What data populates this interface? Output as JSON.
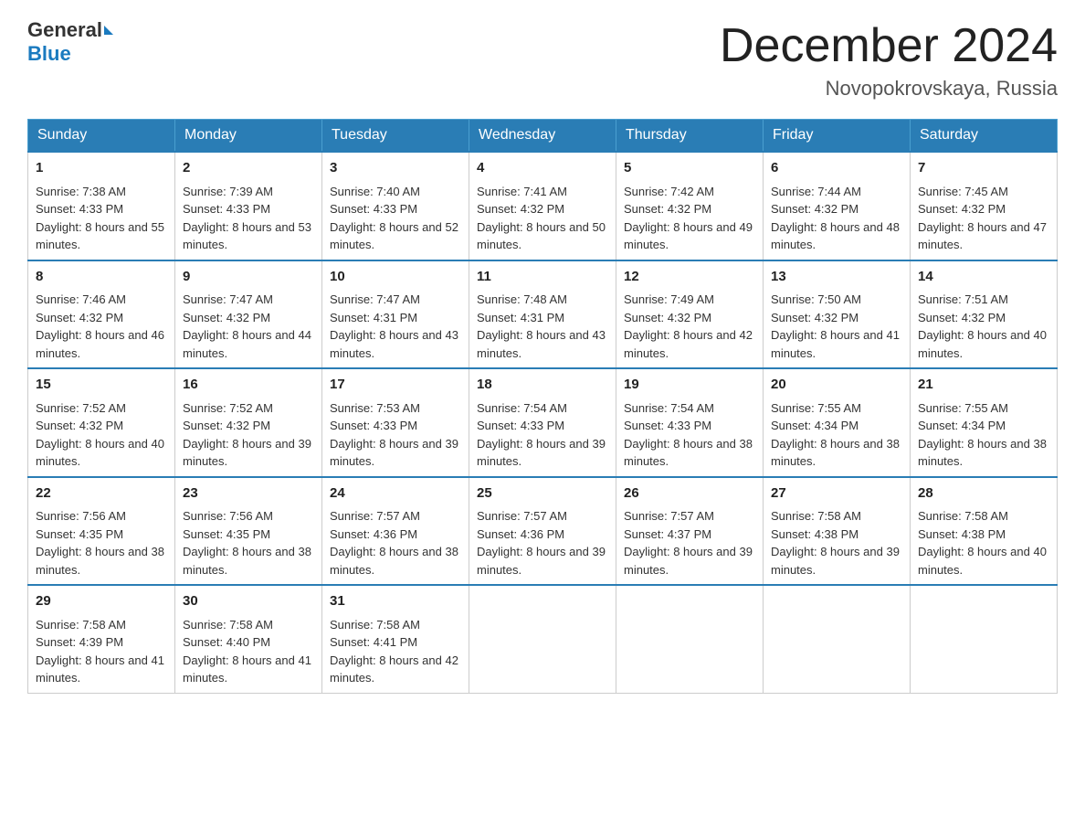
{
  "header": {
    "logo_general": "General",
    "logo_blue": "Blue",
    "month_title": "December 2024",
    "location": "Novopokrovskaya, Russia"
  },
  "days_of_week": [
    "Sunday",
    "Monday",
    "Tuesday",
    "Wednesday",
    "Thursday",
    "Friday",
    "Saturday"
  ],
  "weeks": [
    [
      {
        "day": "1",
        "sunrise": "7:38 AM",
        "sunset": "4:33 PM",
        "daylight": "8 hours and 55 minutes."
      },
      {
        "day": "2",
        "sunrise": "7:39 AM",
        "sunset": "4:33 PM",
        "daylight": "8 hours and 53 minutes."
      },
      {
        "day": "3",
        "sunrise": "7:40 AM",
        "sunset": "4:33 PM",
        "daylight": "8 hours and 52 minutes."
      },
      {
        "day": "4",
        "sunrise": "7:41 AM",
        "sunset": "4:32 PM",
        "daylight": "8 hours and 50 minutes."
      },
      {
        "day": "5",
        "sunrise": "7:42 AM",
        "sunset": "4:32 PM",
        "daylight": "8 hours and 49 minutes."
      },
      {
        "day": "6",
        "sunrise": "7:44 AM",
        "sunset": "4:32 PM",
        "daylight": "8 hours and 48 minutes."
      },
      {
        "day": "7",
        "sunrise": "7:45 AM",
        "sunset": "4:32 PM",
        "daylight": "8 hours and 47 minutes."
      }
    ],
    [
      {
        "day": "8",
        "sunrise": "7:46 AM",
        "sunset": "4:32 PM",
        "daylight": "8 hours and 46 minutes."
      },
      {
        "day": "9",
        "sunrise": "7:47 AM",
        "sunset": "4:32 PM",
        "daylight": "8 hours and 44 minutes."
      },
      {
        "day": "10",
        "sunrise": "7:47 AM",
        "sunset": "4:31 PM",
        "daylight": "8 hours and 43 minutes."
      },
      {
        "day": "11",
        "sunrise": "7:48 AM",
        "sunset": "4:31 PM",
        "daylight": "8 hours and 43 minutes."
      },
      {
        "day": "12",
        "sunrise": "7:49 AM",
        "sunset": "4:32 PM",
        "daylight": "8 hours and 42 minutes."
      },
      {
        "day": "13",
        "sunrise": "7:50 AM",
        "sunset": "4:32 PM",
        "daylight": "8 hours and 41 minutes."
      },
      {
        "day": "14",
        "sunrise": "7:51 AM",
        "sunset": "4:32 PM",
        "daylight": "8 hours and 40 minutes."
      }
    ],
    [
      {
        "day": "15",
        "sunrise": "7:52 AM",
        "sunset": "4:32 PM",
        "daylight": "8 hours and 40 minutes."
      },
      {
        "day": "16",
        "sunrise": "7:52 AM",
        "sunset": "4:32 PM",
        "daylight": "8 hours and 39 minutes."
      },
      {
        "day": "17",
        "sunrise": "7:53 AM",
        "sunset": "4:33 PM",
        "daylight": "8 hours and 39 minutes."
      },
      {
        "day": "18",
        "sunrise": "7:54 AM",
        "sunset": "4:33 PM",
        "daylight": "8 hours and 39 minutes."
      },
      {
        "day": "19",
        "sunrise": "7:54 AM",
        "sunset": "4:33 PM",
        "daylight": "8 hours and 38 minutes."
      },
      {
        "day": "20",
        "sunrise": "7:55 AM",
        "sunset": "4:34 PM",
        "daylight": "8 hours and 38 minutes."
      },
      {
        "day": "21",
        "sunrise": "7:55 AM",
        "sunset": "4:34 PM",
        "daylight": "8 hours and 38 minutes."
      }
    ],
    [
      {
        "day": "22",
        "sunrise": "7:56 AM",
        "sunset": "4:35 PM",
        "daylight": "8 hours and 38 minutes."
      },
      {
        "day": "23",
        "sunrise": "7:56 AM",
        "sunset": "4:35 PM",
        "daylight": "8 hours and 38 minutes."
      },
      {
        "day": "24",
        "sunrise": "7:57 AM",
        "sunset": "4:36 PM",
        "daylight": "8 hours and 38 minutes."
      },
      {
        "day": "25",
        "sunrise": "7:57 AM",
        "sunset": "4:36 PM",
        "daylight": "8 hours and 39 minutes."
      },
      {
        "day": "26",
        "sunrise": "7:57 AM",
        "sunset": "4:37 PM",
        "daylight": "8 hours and 39 minutes."
      },
      {
        "day": "27",
        "sunrise": "7:58 AM",
        "sunset": "4:38 PM",
        "daylight": "8 hours and 39 minutes."
      },
      {
        "day": "28",
        "sunrise": "7:58 AM",
        "sunset": "4:38 PM",
        "daylight": "8 hours and 40 minutes."
      }
    ],
    [
      {
        "day": "29",
        "sunrise": "7:58 AM",
        "sunset": "4:39 PM",
        "daylight": "8 hours and 41 minutes."
      },
      {
        "day": "30",
        "sunrise": "7:58 AM",
        "sunset": "4:40 PM",
        "daylight": "8 hours and 41 minutes."
      },
      {
        "day": "31",
        "sunrise": "7:58 AM",
        "sunset": "4:41 PM",
        "daylight": "8 hours and 42 minutes."
      },
      null,
      null,
      null,
      null
    ]
  ]
}
